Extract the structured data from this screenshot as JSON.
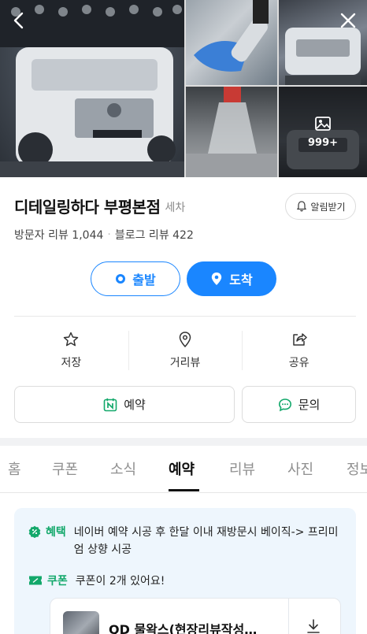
{
  "gallery": {
    "more_count": "999+"
  },
  "place": {
    "name": "디테일링하다 부평본점",
    "category": "세차",
    "notify_label": "알림받기",
    "visitor_reviews": "방문자 리뷰 1,044",
    "separator": "·",
    "blog_reviews": "블로그 리뷰 422"
  },
  "route": {
    "depart_label": "출발",
    "arrive_label": "도착"
  },
  "actions": {
    "save_label": "저장",
    "street_view_label": "거리뷰",
    "share_label": "공유"
  },
  "buttons": {
    "reserve_label": "예약",
    "inquiry_label": "문의"
  },
  "tabs": [
    {
      "label": "홈"
    },
    {
      "label": "쿠폰"
    },
    {
      "label": "소식"
    },
    {
      "label": "예약"
    },
    {
      "label": "리뷰"
    },
    {
      "label": "사진"
    },
    {
      "label": "정보"
    }
  ],
  "info": {
    "benefit_label": "혜택",
    "benefit_text": "네이버 예약 시공 후 한달 이내 재방문시 베이직-> 프리미엄 상향 시공",
    "coupon_label": "쿠폰",
    "coupon_text": "쿠폰이 2개 있어요!",
    "coupon_item_title": "QD 물왁스(현장리뷰작성…"
  },
  "colors": {
    "accent_blue": "#1a86ff",
    "benefit_green": "#13a86b",
    "card_bg": "#eef6fd"
  }
}
